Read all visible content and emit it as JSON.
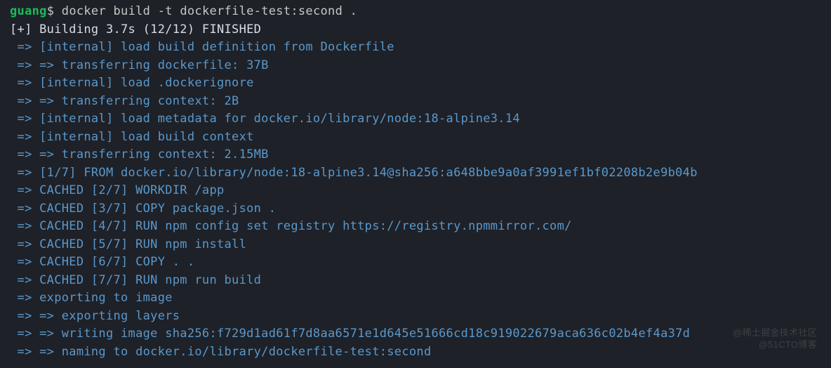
{
  "prompt": {
    "user": "guang",
    "symbol": "$",
    "command": "docker build -t dockerfile-test:second ."
  },
  "build_header": "[+] Building 3.7s (12/12) FINISHED",
  "lines": [
    " => [internal] load build definition from Dockerfile",
    " => => transferring dockerfile: 37B",
    " => [internal] load .dockerignore",
    " => => transferring context: 2B",
    " => [internal] load metadata for docker.io/library/node:18-alpine3.14",
    " => [internal] load build context",
    " => => transferring context: 2.15MB",
    " => [1/7] FROM docker.io/library/node:18-alpine3.14@sha256:a648bbe9a0af3991ef1bf02208b2e9b04b",
    " => CACHED [2/7] WORKDIR /app",
    " => CACHED [3/7] COPY package.json .",
    " => CACHED [4/7] RUN npm config set registry https://registry.npmmirror.com/",
    " => CACHED [5/7] RUN npm install",
    " => CACHED [6/7] COPY . .",
    " => CACHED [7/7] RUN npm run build",
    " => exporting to image",
    " => => exporting layers",
    " => => writing image sha256:f729d1ad61f7d8aa6571e1d645e51666cd18c919022679aca636c02b4ef4a37d",
    " => => naming to docker.io/library/dockerfile-test:second"
  ],
  "watermark": {
    "line1": "@稀土掘金技术社区",
    "line2": "@51CTO博客"
  }
}
